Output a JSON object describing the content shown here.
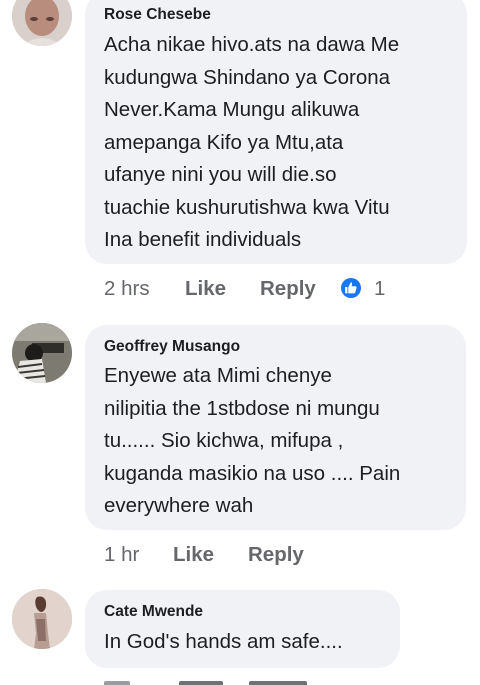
{
  "comments": [
    {
      "author": "Rose Chesebe",
      "text": "Acha nikae hivo.ats na dawa Me\nkudungwa Shindano ya Corona\nNever.Kama Mungu alikuwa\namepanga Kifo ya Mtu,ata\nufanye nini you will die.so\ntuachie kushurutishwa kwa Vitu\nIna benefit individuals",
      "time": "2 hrs",
      "like_label": "Like",
      "reply_label": "Reply",
      "reaction_count": "1",
      "reaction_icon": "thumbs-up-icon",
      "reaction_color": "#1877f2"
    },
    {
      "author": "Geoffrey Musango",
      "text": "Enyewe ata Mimi chenye\nnilipitia the 1stbdose ni mungu\ntu...... Sio kichwa, mifupa ,\nkuganda masikio na uso .... Pain\neverywhere wah",
      "time": "1 hr",
      "like_label": "Like",
      "reply_label": "Reply"
    },
    {
      "author": "Cate Mwende",
      "text": "In God's hands am safe...."
    }
  ]
}
